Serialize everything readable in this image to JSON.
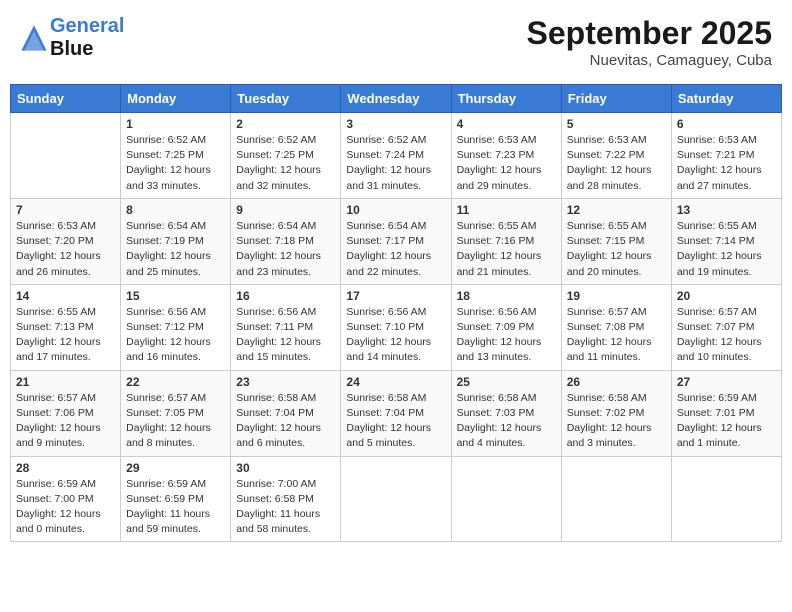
{
  "header": {
    "logo_line1": "General",
    "logo_line2": "Blue",
    "month": "September 2025",
    "location": "Nuevitas, Camaguey, Cuba"
  },
  "weekdays": [
    "Sunday",
    "Monday",
    "Tuesday",
    "Wednesday",
    "Thursday",
    "Friday",
    "Saturday"
  ],
  "weeks": [
    [
      {
        "day": "",
        "info": ""
      },
      {
        "day": "1",
        "info": "Sunrise: 6:52 AM\nSunset: 7:25 PM\nDaylight: 12 hours\nand 33 minutes."
      },
      {
        "day": "2",
        "info": "Sunrise: 6:52 AM\nSunset: 7:25 PM\nDaylight: 12 hours\nand 32 minutes."
      },
      {
        "day": "3",
        "info": "Sunrise: 6:52 AM\nSunset: 7:24 PM\nDaylight: 12 hours\nand 31 minutes."
      },
      {
        "day": "4",
        "info": "Sunrise: 6:53 AM\nSunset: 7:23 PM\nDaylight: 12 hours\nand 29 minutes."
      },
      {
        "day": "5",
        "info": "Sunrise: 6:53 AM\nSunset: 7:22 PM\nDaylight: 12 hours\nand 28 minutes."
      },
      {
        "day": "6",
        "info": "Sunrise: 6:53 AM\nSunset: 7:21 PM\nDaylight: 12 hours\nand 27 minutes."
      }
    ],
    [
      {
        "day": "7",
        "info": "Sunrise: 6:53 AM\nSunset: 7:20 PM\nDaylight: 12 hours\nand 26 minutes."
      },
      {
        "day": "8",
        "info": "Sunrise: 6:54 AM\nSunset: 7:19 PM\nDaylight: 12 hours\nand 25 minutes."
      },
      {
        "day": "9",
        "info": "Sunrise: 6:54 AM\nSunset: 7:18 PM\nDaylight: 12 hours\nand 23 minutes."
      },
      {
        "day": "10",
        "info": "Sunrise: 6:54 AM\nSunset: 7:17 PM\nDaylight: 12 hours\nand 22 minutes."
      },
      {
        "day": "11",
        "info": "Sunrise: 6:55 AM\nSunset: 7:16 PM\nDaylight: 12 hours\nand 21 minutes."
      },
      {
        "day": "12",
        "info": "Sunrise: 6:55 AM\nSunset: 7:15 PM\nDaylight: 12 hours\nand 20 minutes."
      },
      {
        "day": "13",
        "info": "Sunrise: 6:55 AM\nSunset: 7:14 PM\nDaylight: 12 hours\nand 19 minutes."
      }
    ],
    [
      {
        "day": "14",
        "info": "Sunrise: 6:55 AM\nSunset: 7:13 PM\nDaylight: 12 hours\nand 17 minutes."
      },
      {
        "day": "15",
        "info": "Sunrise: 6:56 AM\nSunset: 7:12 PM\nDaylight: 12 hours\nand 16 minutes."
      },
      {
        "day": "16",
        "info": "Sunrise: 6:56 AM\nSunset: 7:11 PM\nDaylight: 12 hours\nand 15 minutes."
      },
      {
        "day": "17",
        "info": "Sunrise: 6:56 AM\nSunset: 7:10 PM\nDaylight: 12 hours\nand 14 minutes."
      },
      {
        "day": "18",
        "info": "Sunrise: 6:56 AM\nSunset: 7:09 PM\nDaylight: 12 hours\nand 13 minutes."
      },
      {
        "day": "19",
        "info": "Sunrise: 6:57 AM\nSunset: 7:08 PM\nDaylight: 12 hours\nand 11 minutes."
      },
      {
        "day": "20",
        "info": "Sunrise: 6:57 AM\nSunset: 7:07 PM\nDaylight: 12 hours\nand 10 minutes."
      }
    ],
    [
      {
        "day": "21",
        "info": "Sunrise: 6:57 AM\nSunset: 7:06 PM\nDaylight: 12 hours\nand 9 minutes."
      },
      {
        "day": "22",
        "info": "Sunrise: 6:57 AM\nSunset: 7:05 PM\nDaylight: 12 hours\nand 8 minutes."
      },
      {
        "day": "23",
        "info": "Sunrise: 6:58 AM\nSunset: 7:04 PM\nDaylight: 12 hours\nand 6 minutes."
      },
      {
        "day": "24",
        "info": "Sunrise: 6:58 AM\nSunset: 7:04 PM\nDaylight: 12 hours\nand 5 minutes."
      },
      {
        "day": "25",
        "info": "Sunrise: 6:58 AM\nSunset: 7:03 PM\nDaylight: 12 hours\nand 4 minutes."
      },
      {
        "day": "26",
        "info": "Sunrise: 6:58 AM\nSunset: 7:02 PM\nDaylight: 12 hours\nand 3 minutes."
      },
      {
        "day": "27",
        "info": "Sunrise: 6:59 AM\nSunset: 7:01 PM\nDaylight: 12 hours\nand 1 minute."
      }
    ],
    [
      {
        "day": "28",
        "info": "Sunrise: 6:59 AM\nSunset: 7:00 PM\nDaylight: 12 hours\nand 0 minutes."
      },
      {
        "day": "29",
        "info": "Sunrise: 6:59 AM\nSunset: 6:59 PM\nDaylight: 11 hours\nand 59 minutes."
      },
      {
        "day": "30",
        "info": "Sunrise: 7:00 AM\nSunset: 6:58 PM\nDaylight: 11 hours\nand 58 minutes."
      },
      {
        "day": "",
        "info": ""
      },
      {
        "day": "",
        "info": ""
      },
      {
        "day": "",
        "info": ""
      },
      {
        "day": "",
        "info": ""
      }
    ]
  ]
}
